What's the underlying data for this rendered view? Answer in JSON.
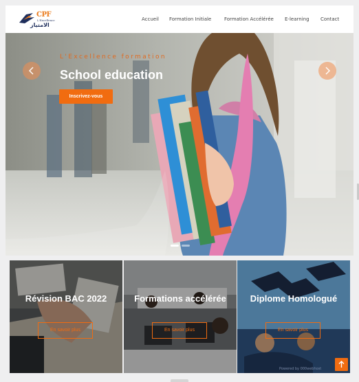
{
  "brand": {
    "name": "CPF",
    "subtitle": "L'Excellence",
    "arabic": "الامتياز"
  },
  "nav": {
    "items": [
      "Accueil",
      "Formation Initiale",
      "Formation Accélérée",
      "E-learning",
      "Contact"
    ]
  },
  "hero": {
    "tagline": "L'Excellence formation",
    "title": "School education",
    "cta": "Inscrivez-vous",
    "slides": 2,
    "active_slide": 1
  },
  "cards": [
    {
      "title": "Révision BAC 2022",
      "button": "En savoir plus"
    },
    {
      "title": "Formations accélérée",
      "button": "En savoir plus"
    },
    {
      "title": "Diplome Homologué",
      "button": "En savoir plus"
    }
  ],
  "footer": {
    "powered_by": "Powered by 000webhost"
  },
  "colors": {
    "accent": "#f16c10",
    "brand_navy": "#1e2e5c",
    "nav_text": "#444444"
  },
  "icons": [
    "logo-mark",
    "chevron-left-icon",
    "chevron-right-icon",
    "arrow-up-icon"
  ]
}
